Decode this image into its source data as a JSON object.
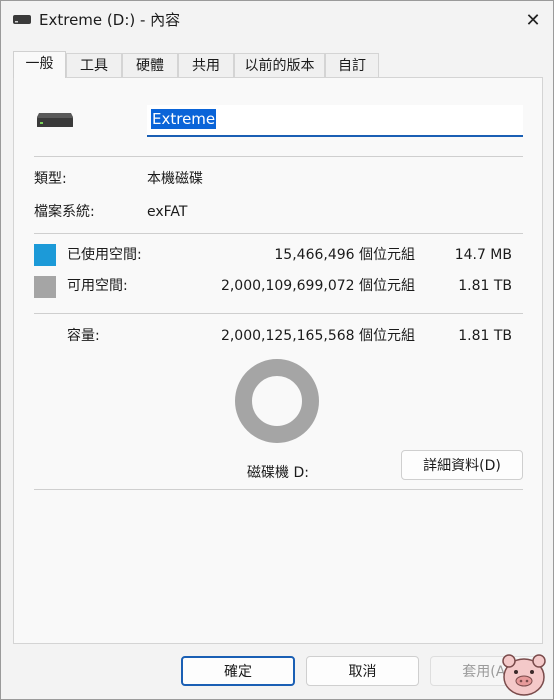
{
  "window": {
    "title": "Extreme (D:) - 內容",
    "close_glyph": "✕"
  },
  "tabs": [
    {
      "label": "一般",
      "active": true
    },
    {
      "label": "工具",
      "active": false
    },
    {
      "label": "硬體",
      "active": false
    },
    {
      "label": "共用",
      "active": false
    },
    {
      "label": "以前的版本",
      "active": false
    },
    {
      "label": "自訂",
      "active": false
    }
  ],
  "general": {
    "drive_icon": "drive-icon",
    "name_value": "Extreme",
    "type_label": "類型:",
    "type_value": "本機磁碟",
    "fs_label": "檔案系統:",
    "fs_value": "exFAT",
    "used": {
      "label": "已使用空間:",
      "bytes": "15,466,496 個位元組",
      "size": "14.7 MB",
      "color": "#1c9ad8"
    },
    "free": {
      "label": "可用空間:",
      "bytes": "2,000,109,699,072 個位元組",
      "size": "1.81 TB",
      "color": "#a5a5a5"
    },
    "capacity": {
      "label": "容量:",
      "bytes": "2,000,125,165,568 個位元組",
      "size": "1.81 TB"
    },
    "drive_label": "磁碟機 D:",
    "details_button": "詳細資料(D)",
    "used_fraction": 7.7e-06
  },
  "buttons": {
    "ok": "確定",
    "cancel": "取消",
    "apply": "套用(A)"
  },
  "colors": {
    "accent": "#1a5fb4",
    "used": "#1c9ad8",
    "free": "#a5a5a5"
  }
}
